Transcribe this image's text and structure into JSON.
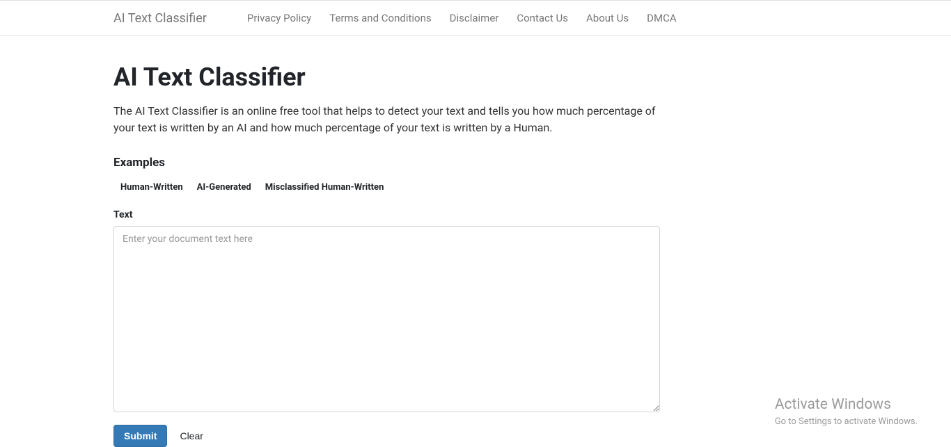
{
  "navbar": {
    "brand": "AI Text Classifier",
    "links": [
      {
        "label": "Privacy Policy"
      },
      {
        "label": "Terms and Conditions"
      },
      {
        "label": "Disclaimer"
      },
      {
        "label": "Contact Us"
      },
      {
        "label": "About Us"
      },
      {
        "label": "DMCA"
      }
    ]
  },
  "main": {
    "title": "AI Text Classifier",
    "description": "The AI Text Classifier is an online free tool that helps to detect your text and tells you how much percentage of your text is written by an AI and how much percentage of your text is written by a Human.",
    "examples_heading": "Examples",
    "tabs": [
      {
        "label": "Human-Written"
      },
      {
        "label": "AI-Generated"
      },
      {
        "label": "Misclassified Human-Written"
      }
    ],
    "text_label": "Text",
    "textarea_placeholder": "Enter your document text here",
    "textarea_value": "",
    "submit_label": "Submit",
    "clear_label": "Clear"
  },
  "watermark": {
    "line1": "Activate Windows",
    "line2": "Go to Settings to activate Windows."
  }
}
